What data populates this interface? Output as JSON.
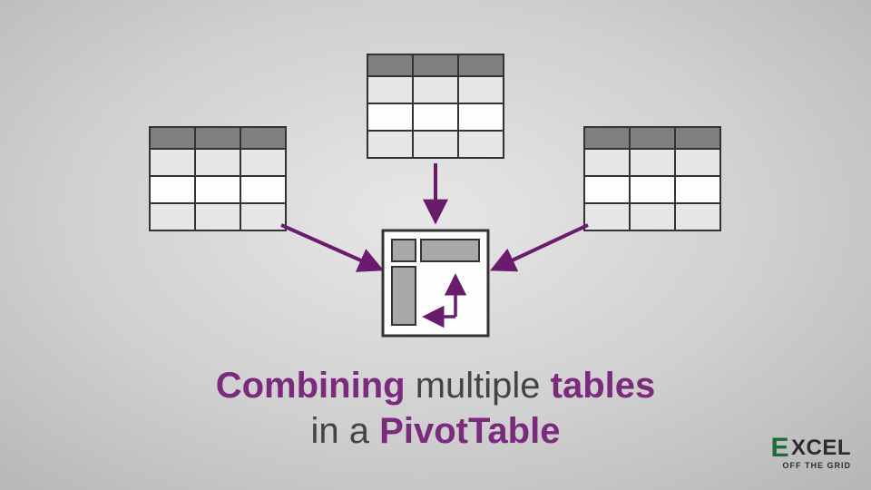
{
  "title": {
    "w1": "Combining",
    "w2": "multiple",
    "w3": "tables",
    "w4": "in a",
    "w5": "PivotTable"
  },
  "logo": {
    "letterE": "E",
    "rest": "XCEL",
    "tagline": "OFF THE GRID"
  },
  "diagram": {
    "sourceTables": 3,
    "targetLabel": "PivotTable",
    "arrowColor": "#6a1b6d",
    "tableHeaderFill": "#7f7f7f",
    "tableRowLight": "#fdfdfd",
    "tableRowAlt": "#e6e6e6",
    "pivotBoxFill": "#a8a8a8",
    "strokeColor": "#333333"
  }
}
